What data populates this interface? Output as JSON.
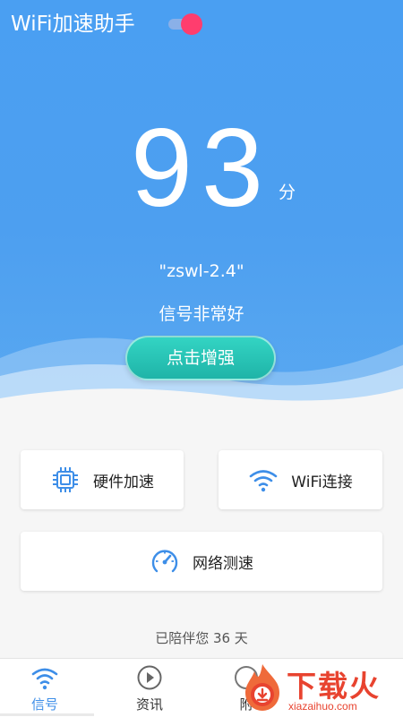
{
  "app": {
    "title": "WiFi加速助手"
  },
  "score": {
    "value": "93",
    "unit": "分"
  },
  "network": {
    "ssid": "\"zswl-2.4\"",
    "signal": "信号非常好"
  },
  "actions": {
    "boost_label": "点击增强"
  },
  "cards": [
    {
      "label": "硬件加速",
      "icon": "chip-icon"
    },
    {
      "label": "WiFi连接",
      "icon": "wifi-icon"
    },
    {
      "label": "网络测速",
      "icon": "speedometer-icon"
    }
  ],
  "footer": {
    "companion_text": "已陪伴您 36 天"
  },
  "tabs": [
    {
      "label": "信号",
      "icon": "wifi-icon",
      "active": true
    },
    {
      "label": "资讯",
      "icon": "play-icon"
    },
    {
      "label": "附",
      "icon": "unknown-icon"
    }
  ],
  "watermark": {
    "text": "下载火",
    "sub": "xiazaihuo.com"
  },
  "colors": {
    "primary": "#4a9ff2",
    "accent": "#ff3d6e",
    "button": "#26c2b4",
    "tab_active": "#3d8ee8",
    "watermark": "#e8432f"
  }
}
